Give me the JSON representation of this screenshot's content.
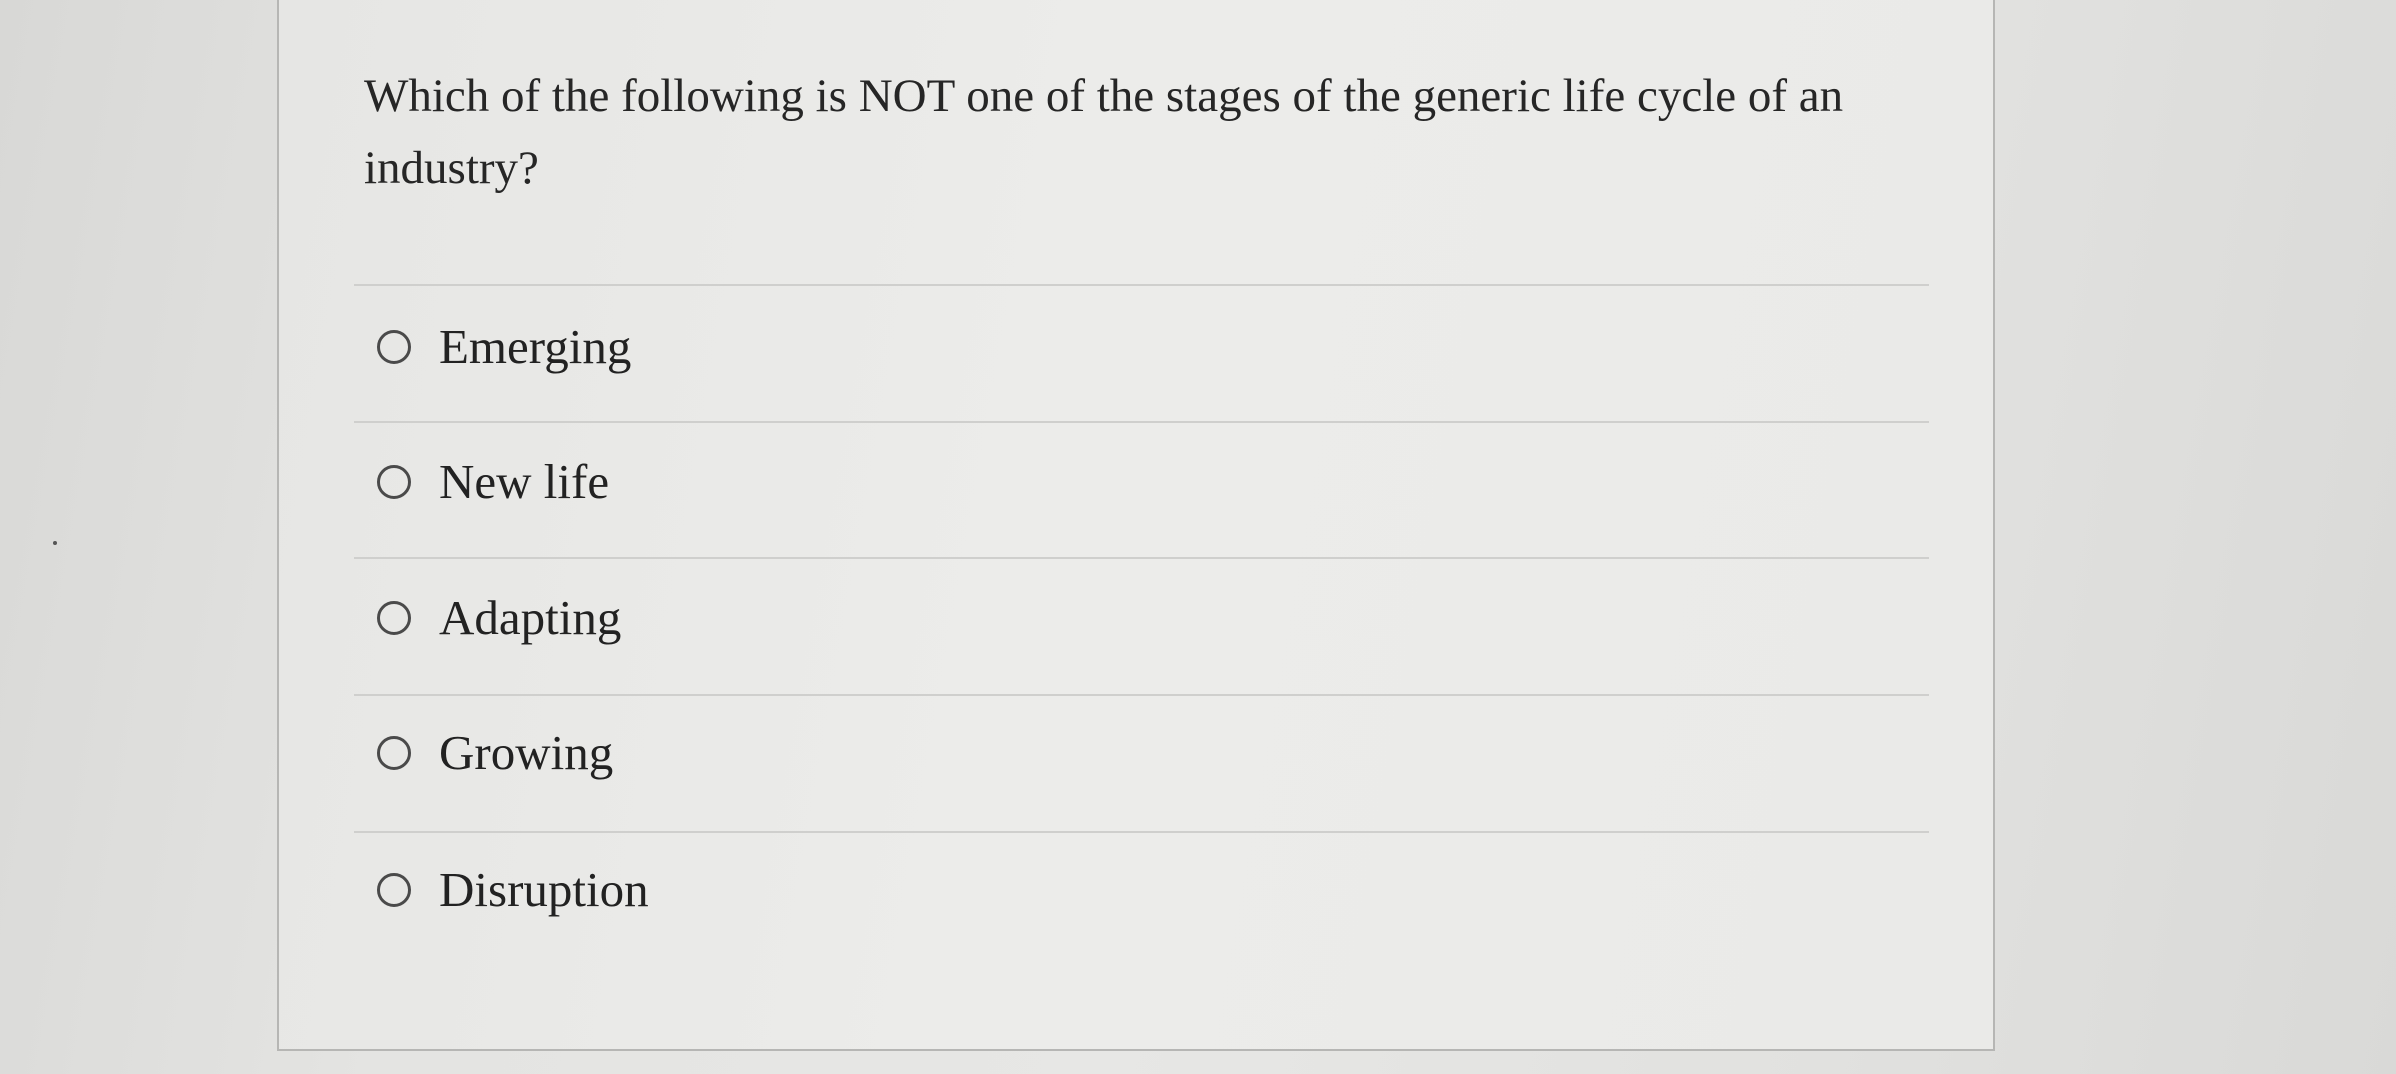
{
  "question": {
    "text": "Which of the following is NOT one of the stages of the generic life cycle of an industry?"
  },
  "options": [
    {
      "label": "Emerging",
      "selected": false
    },
    {
      "label": "New life",
      "selected": false
    },
    {
      "label": "Adapting",
      "selected": false
    },
    {
      "label": "Growing",
      "selected": false
    },
    {
      "label": "Disruption",
      "selected": false
    }
  ]
}
